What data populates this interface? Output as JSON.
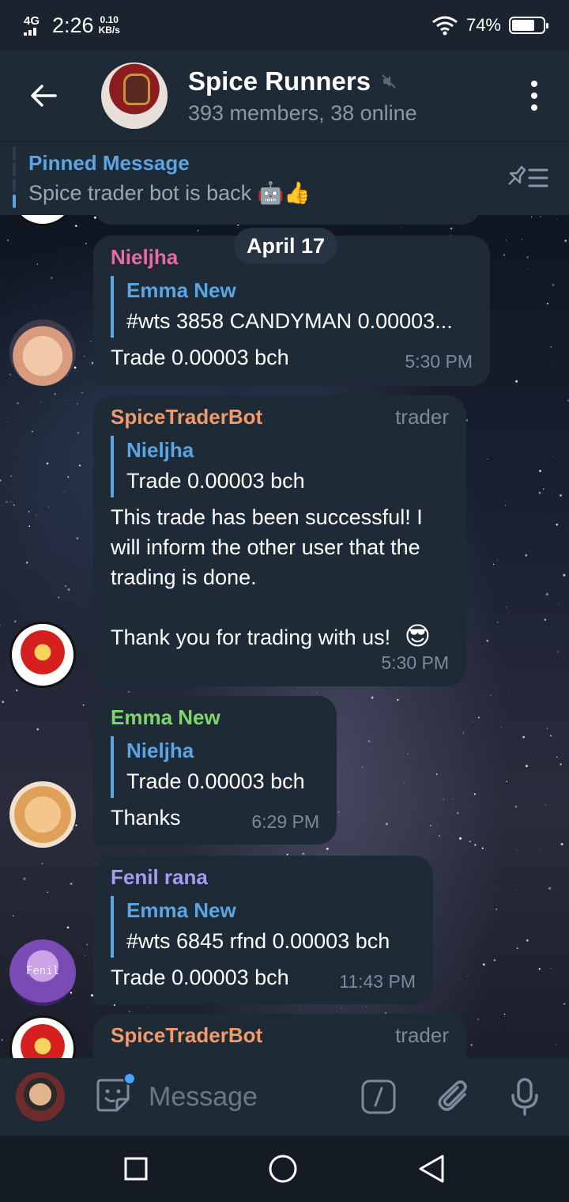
{
  "status_bar": {
    "network": "4G",
    "time": "2:26",
    "speed_value": "0.10",
    "speed_unit": "KB/s",
    "battery": "74%",
    "battery_level": 0.74
  },
  "header": {
    "title": "Spice Runners",
    "subtitle": "393 members, 38 online",
    "muted": true
  },
  "pinned": {
    "title": "Pinned Message",
    "text": "Spice trader bot is back 🤖👍"
  },
  "chat": {
    "date": "April 17",
    "messages": [
      {
        "sender": "Nieljha",
        "sender_color": "#e86aa0",
        "quote_name": "Emma New",
        "quote_text": "#wts 3858 CANDYMAN 0.00003...",
        "text": "Trade 0.00003 bch",
        "time": "5:30 PM"
      },
      {
        "sender": "SpiceTraderBot",
        "sender_color": "#f29a6a",
        "badge": "trader",
        "quote_name": "Nieljha",
        "quote_text": "Trade 0.00003 bch",
        "text": "This trade has been successful! I will inform the other user that the trading is done.",
        "text2": "Thank you for trading with us! ",
        "emoji": "😎",
        "time": "5:30 PM"
      },
      {
        "sender": "Emma New",
        "sender_color": "#7fd66a",
        "quote_name": "Nieljha",
        "quote_text": "Trade 0.00003 bch",
        "text": "Thanks",
        "time": "6:29 PM"
      },
      {
        "sender": "Fenil rana",
        "sender_color": "#a39cf2",
        "quote_name": "Emma New",
        "quote_text": "#wts 6845 rfnd 0.00003 bch",
        "text": "Trade 0.00003 bch",
        "time": "11:43 PM"
      },
      {
        "sender": "SpiceTraderBot",
        "sender_color": "#f29a6a",
        "badge": "trader"
      }
    ],
    "fenil_avatar_text": "Fenil"
  },
  "composer": {
    "placeholder": "Message"
  }
}
